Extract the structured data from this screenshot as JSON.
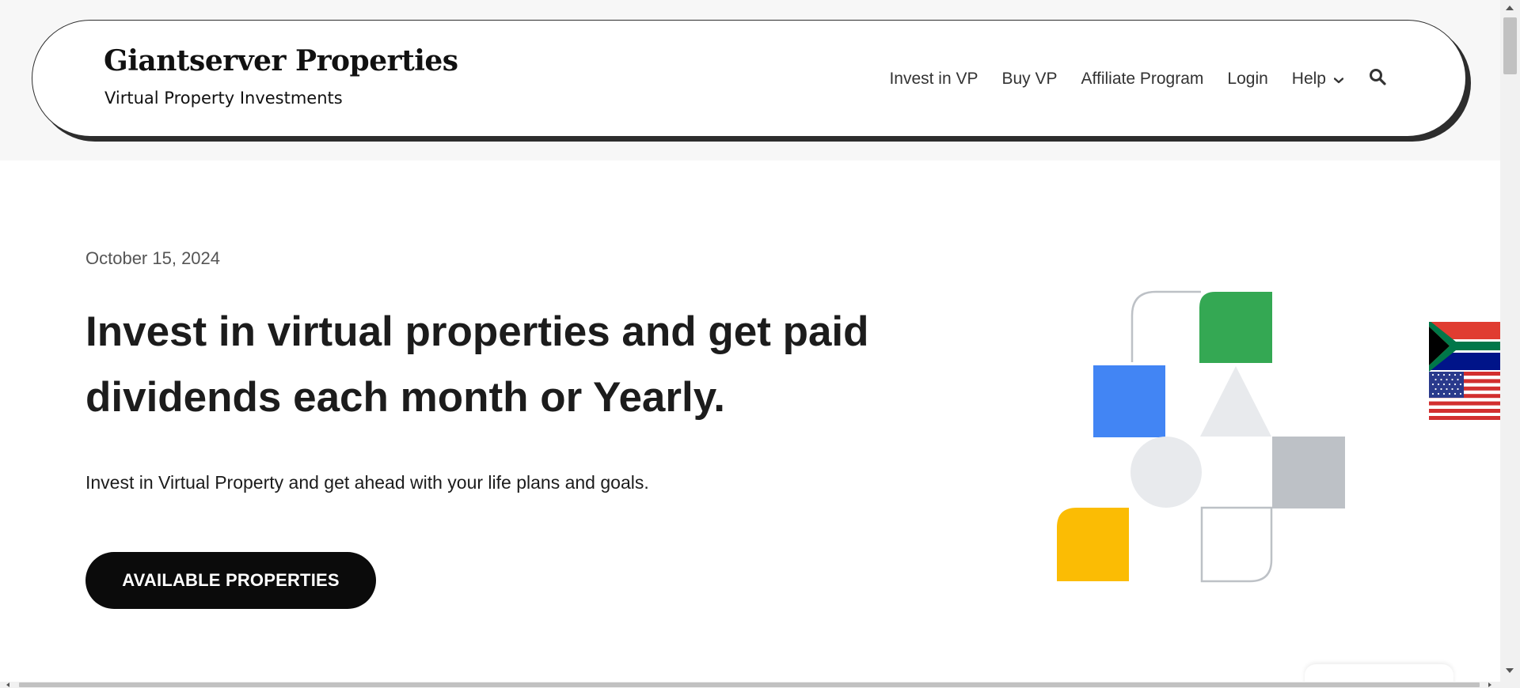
{
  "site": {
    "title": "Giantserver Properties",
    "tagline": "Virtual Property Investments"
  },
  "nav": {
    "items": [
      {
        "label": "Invest in VP"
      },
      {
        "label": "Buy VP"
      },
      {
        "label": "Affiliate Program"
      },
      {
        "label": "Login"
      },
      {
        "label": "Help",
        "icon": "chevron-down-icon"
      }
    ],
    "search_icon": "search-icon"
  },
  "hero": {
    "date": "October 15, 2024",
    "title": "Invest in virtual properties and get paid dividends each month or Yearly.",
    "description": "Invest in Virtual Property and get ahead with your life plans and goals.",
    "cta_label": "AVAILABLE PROPERTIES"
  },
  "colors": {
    "green": "#34a853",
    "blue": "#4285f4",
    "yellow": "#fbbc04",
    "light_gray": "#e8eaed",
    "mid_gray": "#bdc1c6",
    "cta_bg": "#0b0b0b",
    "header_shadow": "#2d2d2d"
  },
  "language_flags": [
    "South Africa",
    "United States"
  ]
}
